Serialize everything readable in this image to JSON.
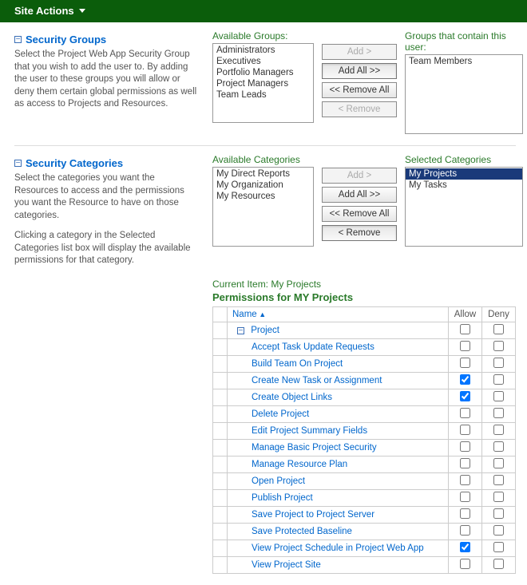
{
  "topbar": {
    "label": "Site Actions"
  },
  "sections": {
    "groups": {
      "title": "Security Groups",
      "desc": "Select the Project Web App Security Group that you wish to add the user to. By adding the user to these groups you will allow or deny them certain global permissions as well as access to Projects and Resources.",
      "available_label": "Available Groups:",
      "selected_label": "Groups that contain this user:",
      "available": [
        "Administrators",
        "Executives",
        "Portfolio Managers",
        "Project Managers",
        "Team Leads"
      ],
      "selected": [
        "Team Members"
      ],
      "buttons": {
        "add": "Add >",
        "addall": "Add All >>",
        "removeall": "<< Remove All",
        "remove": "< Remove"
      }
    },
    "categories": {
      "title": "Security Categories",
      "desc1": "Select the categories you want the Resources to access and the permissions you want the Resource to have on those categories.",
      "desc2": "Clicking a category in the Selected Categories list box will display the available permissions for that category.",
      "available_label": "Available Categories",
      "selected_label": "Selected Categories",
      "available": [
        "My Direct Reports",
        "My Organization",
        "My Resources"
      ],
      "selected": [
        {
          "label": "My Projects",
          "selected": true
        },
        {
          "label": "My Tasks",
          "selected": false
        }
      ],
      "buttons": {
        "add": "Add >",
        "addall": "Add All >>",
        "removeall": "<< Remove All",
        "remove": "< Remove"
      }
    }
  },
  "current_item": "Current Item: My Projects",
  "perm_title": "Permissions for MY Projects",
  "perm_cols": {
    "name": "Name",
    "allow": "Allow",
    "deny": "Deny"
  },
  "perm_group": "Project",
  "permissions": [
    {
      "name": "Accept Task Update Requests",
      "allow": false,
      "deny": false
    },
    {
      "name": "Build Team On Project",
      "allow": false,
      "deny": false
    },
    {
      "name": "Create New Task or Assignment",
      "allow": true,
      "deny": false
    },
    {
      "name": "Create Object Links",
      "allow": true,
      "deny": false
    },
    {
      "name": "Delete Project",
      "allow": false,
      "deny": false
    },
    {
      "name": "Edit Project Summary Fields",
      "allow": false,
      "deny": false
    },
    {
      "name": "Manage Basic Project Security",
      "allow": false,
      "deny": false
    },
    {
      "name": "Manage Resource Plan",
      "allow": false,
      "deny": false
    },
    {
      "name": "Open Project",
      "allow": false,
      "deny": false
    },
    {
      "name": "Publish Project",
      "allow": false,
      "deny": false
    },
    {
      "name": "Save Project to Project Server",
      "allow": false,
      "deny": false
    },
    {
      "name": "Save Protected Baseline",
      "allow": false,
      "deny": false
    },
    {
      "name": "View Project Schedule in Project Web App",
      "allow": true,
      "deny": false
    },
    {
      "name": "View Project Site",
      "allow": false,
      "deny": false
    }
  ]
}
